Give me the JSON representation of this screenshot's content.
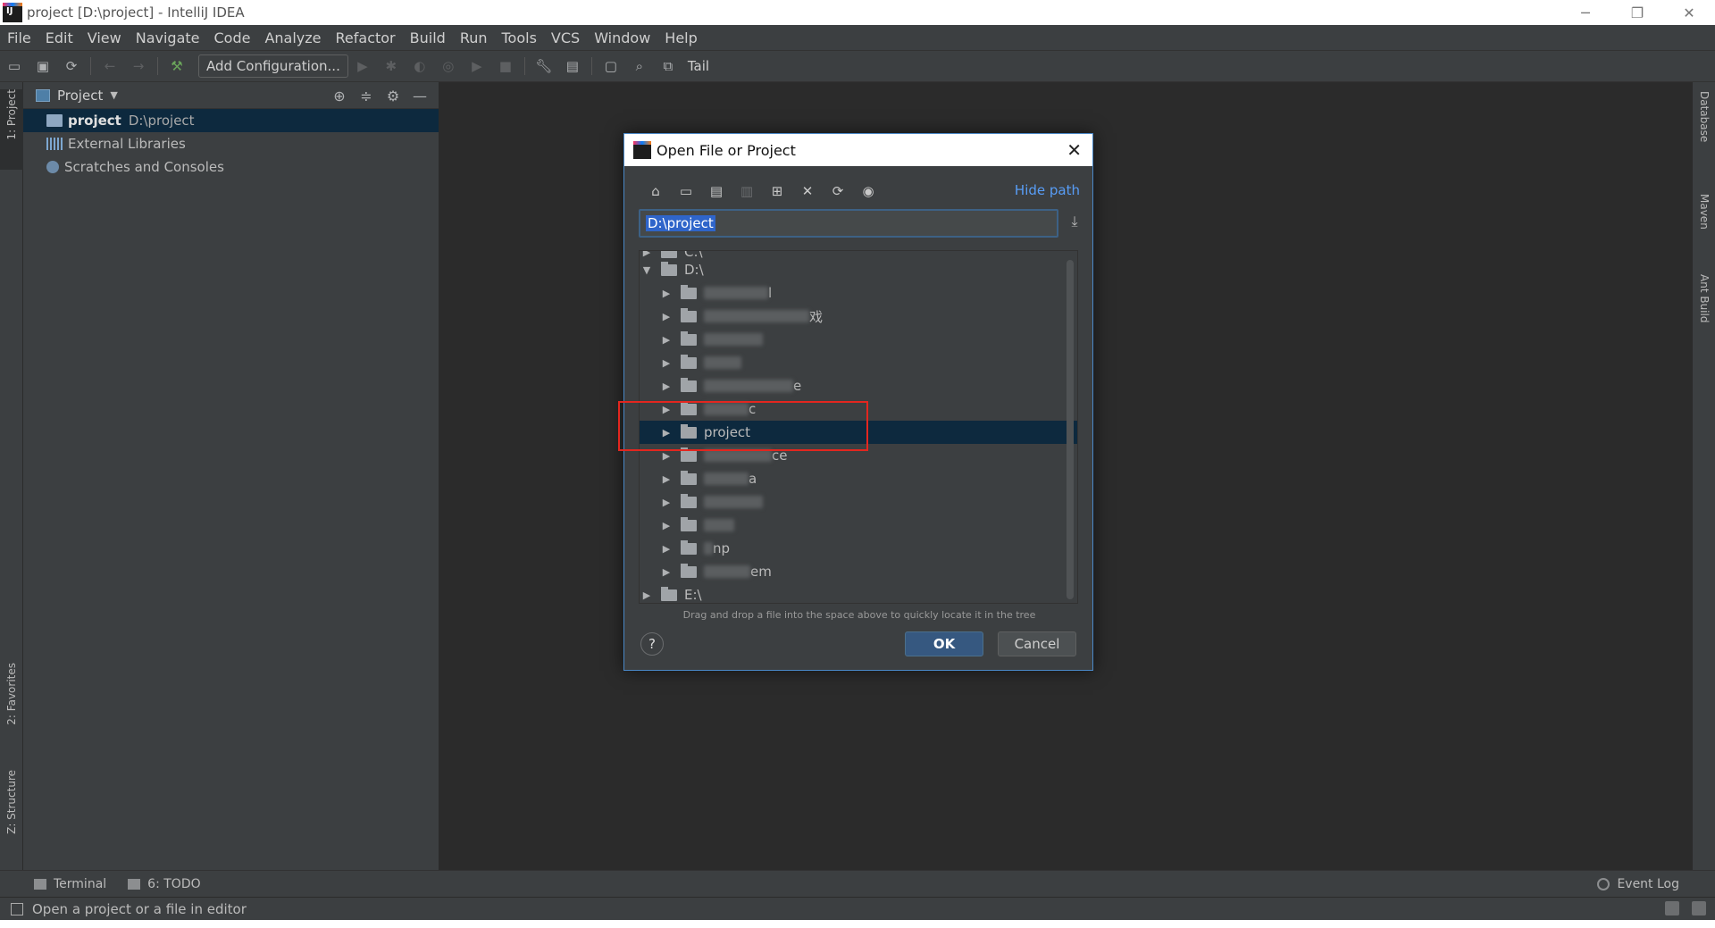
{
  "window": {
    "title": "project [D:\\project] - IntelliJ IDEA",
    "controls": [
      "─",
      "❐",
      "✕"
    ]
  },
  "menu": [
    "File",
    "Edit",
    "View",
    "Navigate",
    "Code",
    "Analyze",
    "Refactor",
    "Build",
    "Run",
    "Tools",
    "VCS",
    "Window",
    "Help"
  ],
  "toolbar": {
    "add_configuration": "Add Configuration...",
    "tail": "Tail"
  },
  "left_strip": {
    "project_tab": "1: Project",
    "favorites_tab": "2: Favorites",
    "structure_tab": "Z: Structure"
  },
  "right_strip": {
    "database_tab": "Database",
    "maven_tab": "Maven",
    "ant_tab": "Ant Build"
  },
  "project_panel": {
    "title": "Project",
    "rows": [
      {
        "name": "project",
        "path": "D:\\project"
      },
      {
        "name": "External Libraries"
      },
      {
        "name": "Scratches and Consoles"
      }
    ]
  },
  "dialog": {
    "title": "Open File or Project",
    "hide_path": "Hide path",
    "path_value": "D:\\project",
    "tree": {
      "c_drive": "C:\\",
      "d_drive": "D:\\",
      "selected_folder": "project",
      "e_drive": "E:\\",
      "partial_labels": [
        "l",
        "戏",
        "e",
        "c",
        "ce",
        "a",
        "np",
        "em"
      ]
    },
    "drag_hint": "Drag and drop a file into the space above to quickly locate it in the tree",
    "help": "?",
    "ok": "OK",
    "cancel": "Cancel"
  },
  "bottom_bar": {
    "terminal": "Terminal",
    "todo": "6: TODO",
    "event_log": "Event Log"
  },
  "status_bar": {
    "message": "Open a project or a file in editor"
  },
  "colors": {
    "accent": "#365880",
    "selection": "#0d293e",
    "annotation": "#e3261f",
    "link": "#589df6"
  }
}
